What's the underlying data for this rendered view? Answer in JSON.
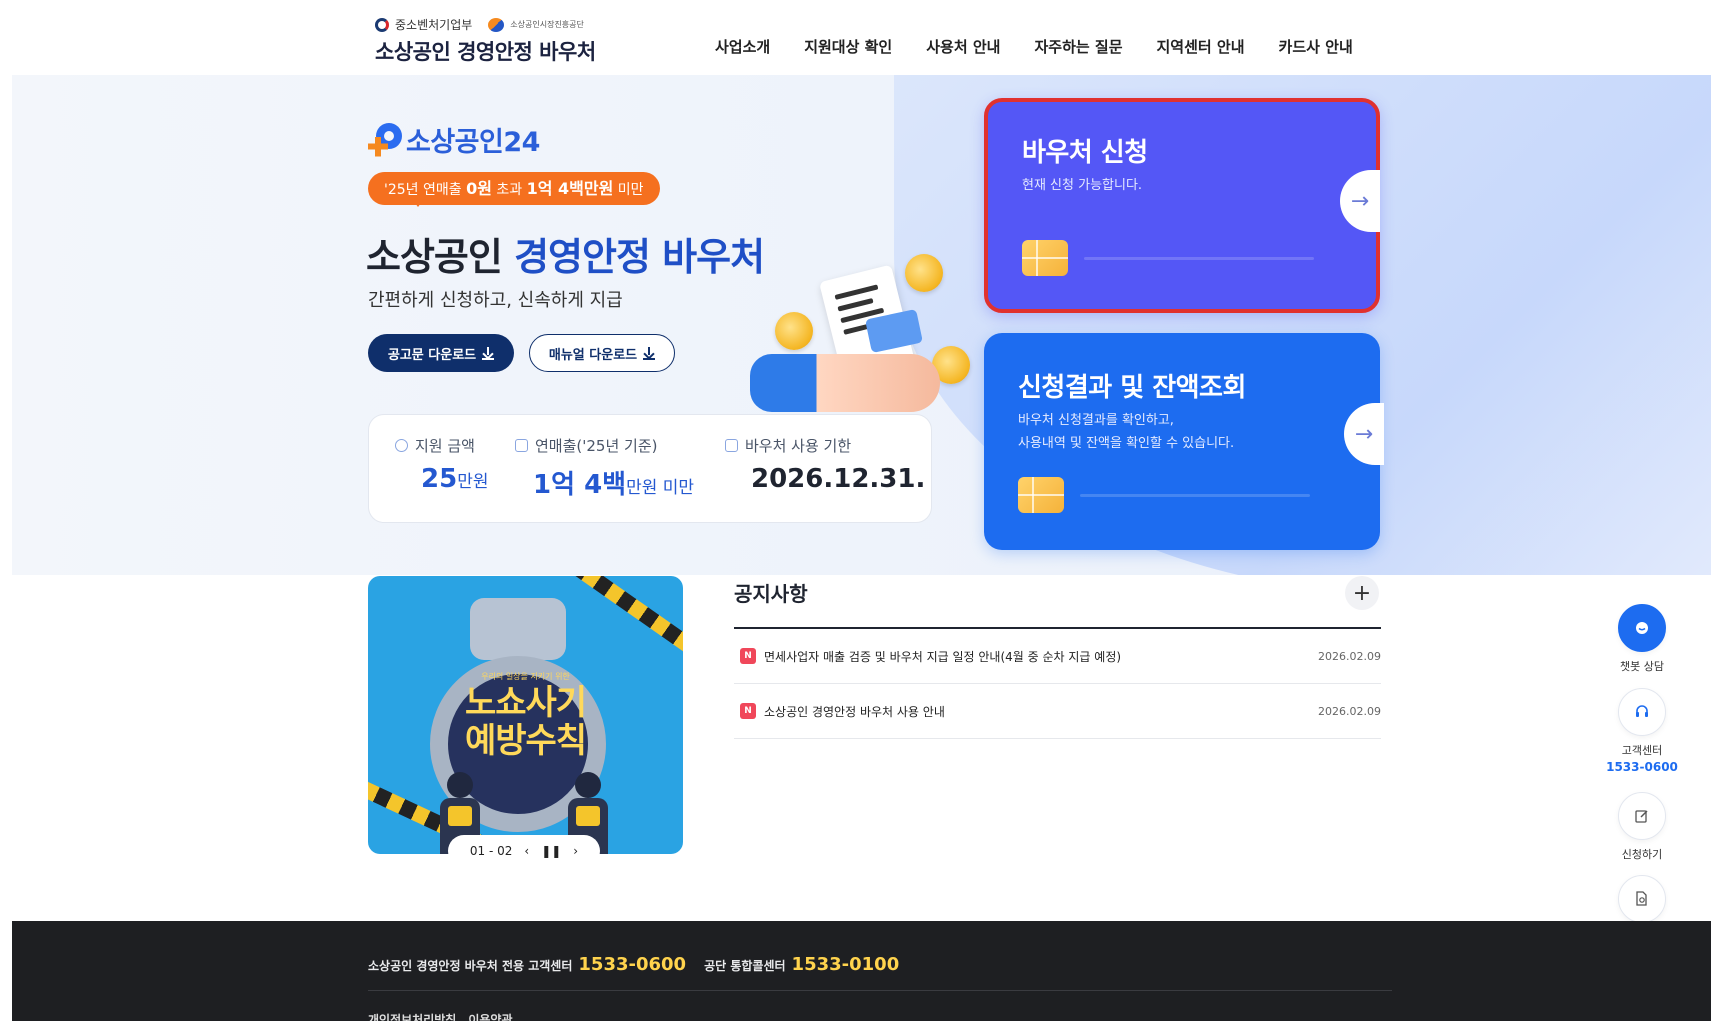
{
  "header": {
    "ministry": "중소벤처기업부",
    "agency": "소상공인시장진흥공단",
    "site_title": "소상공인 경영안정 바우처",
    "nav": [
      "사업소개",
      "지원대상 확인",
      "사용처 안내",
      "자주하는 질문",
      "지역센터 안내",
      "카드사 안내"
    ]
  },
  "hero": {
    "brand": "소상공인24",
    "badge": {
      "prefix": "'25년 연매출",
      "a": "0원",
      "mid": "초과",
      "b": "1억 4백만원",
      "suffix": "미만"
    },
    "title_plain": "소상공인",
    "title_highlight": "경영안정 바우처",
    "subtitle": "간편하게 신청하고, 신속하게 지급",
    "btn_notice": "공고문 다운로드",
    "btn_manual": "매뉴얼 다운로드",
    "info": [
      {
        "label": "지원 금액",
        "value": "25",
        "unit": "만원"
      },
      {
        "label": "연매출('25년 기준)",
        "value": "1억 4백",
        "unit": "만원 미만"
      },
      {
        "label": "바우처 사용 기한",
        "value": "2026.12.31.",
        "unit": ""
      }
    ]
  },
  "cards": {
    "apply": {
      "title": "바우처 신청",
      "desc": "현재 신청 가능합니다."
    },
    "result": {
      "title": "신청결과 및 잔액조회",
      "desc1": "바우처 신청결과를 확인하고,",
      "desc2": "사용내역 및 잔액을 확인할 수 있습니다."
    }
  },
  "banner": {
    "sub": "우리의 일상을 지키기 위한",
    "line1": "노쇼사기",
    "line2": "예방수칙",
    "pager": "01 - 02"
  },
  "notices": {
    "title": "공지사항",
    "items": [
      {
        "badge": "N",
        "title": "면세사업자 매출 검증 및 바우처 지급 일정 안내(4월 중 순차 지급 예정)",
        "date": "2026.02.09"
      },
      {
        "badge": "N",
        "title": "소상공인 경영안정 바우처 사용 안내",
        "date": "2026.02.09"
      }
    ]
  },
  "quick": {
    "chatbot": "챗봇 상담",
    "center": "고객센터",
    "center_phone": "1533-0600",
    "apply": "신청하기"
  },
  "footer": {
    "label1": "소상공인 경영안정 바우처 전용 고객센터",
    "phone1": "1533-0600",
    "label2": "공단 통합콜센터",
    "phone2": "1533-0100",
    "link1": "개인정보처리방침",
    "link2": "이용약관"
  },
  "colors": {
    "apply_card": "#5457f6",
    "result_card": "#1d6cf0",
    "highlight_border": "#e0312f",
    "badge_orange": "#f5701f",
    "footer_phone": "#ffd34d"
  }
}
